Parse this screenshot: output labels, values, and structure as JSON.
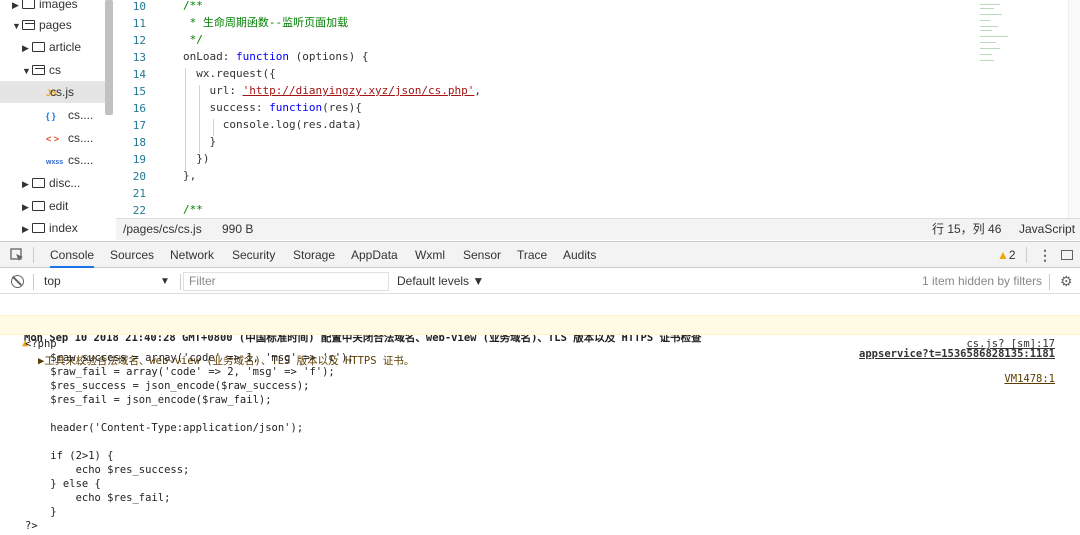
{
  "file_tree": {
    "items": [
      {
        "label": "images",
        "kind": "folder",
        "open": false
      },
      {
        "label": "pages",
        "kind": "folder",
        "open": true
      },
      {
        "label": "article",
        "kind": "folder",
        "open": false
      },
      {
        "label": "cs",
        "kind": "folder",
        "open": true
      },
      {
        "label": "cs.js",
        "kind": "js",
        "icon": "JS"
      },
      {
        "label": "cs....",
        "kind": "json",
        "icon": "{ }"
      },
      {
        "label": "cs....",
        "kind": "wxml",
        "icon": "< >"
      },
      {
        "label": "cs....",
        "kind": "wxss",
        "icon": "wxss"
      },
      {
        "label": "disc...",
        "kind": "folder",
        "open": false
      },
      {
        "label": "edit",
        "kind": "folder",
        "open": false
      },
      {
        "label": "index",
        "kind": "folder",
        "open": false
      }
    ]
  },
  "editor": {
    "line_numbers": [
      "10",
      "11",
      "12",
      "13",
      "14",
      "15",
      "16",
      "17",
      "18",
      "19",
      "20",
      "21",
      "22"
    ],
    "status_path": "/pages/cs/cs.js",
    "status_size": "990 B",
    "status_cursor": "行 15，列 46",
    "status_lang": "JavaScript"
  },
  "devtools": {
    "tabs": [
      "Console",
      "Sources",
      "Network",
      "Security",
      "Storage",
      "AppData",
      "Wxml",
      "Sensor",
      "Trace",
      "Audits"
    ],
    "active_tab": "Console",
    "warning_count": "2",
    "context": "top",
    "filter_placeholder": "Filter",
    "levels": "Default levels ▼",
    "hidden": "1 item hidden by filters"
  },
  "console": {
    "group_header": "Mon Sep 10 2018 21:40:28 GMT+0800 (中国标准时间) 配置中关闭合法域名、web-view (业务域名)、TLS 版本以及 HTTPS 证书检查",
    "group_link": "appservice?t=1536586828135:1181",
    "warning_text": "▶工具未校验合法域名、web-view (业务域名)、TLS 版本以及 HTTPS 证书。",
    "warning_link": "VM1478:1",
    "log_link": "cs.js? [sm]:17",
    "log_lines": [
      "<?php",
      "    $raw_success = array('code' => 1, 'msg' => 'c');",
      "    $raw_fail = array('code' => 2, 'msg' => 'f');",
      "    $res_success = json_encode($raw_success);",
      "    $res_fail = json_encode($raw_fail);",
      "",
      "    header('Content-Type:application/json');",
      "",
      "    if (2>1) {",
      "        echo $res_success;",
      "    } else {",
      "        echo $res_fail;",
      "    }",
      "?>"
    ]
  },
  "code": {
    "l10": "/**",
    "l11": " * 生命周期函数--监听页面加载",
    "l12": " */",
    "l13a": "onLoad: ",
    "l13b": "function",
    "l13c": " (options) {",
    "l14": "  wx.request({",
    "l15a": "    url: ",
    "l15b": "'http://dianyingzy.xyz/json/cs.php'",
    "l15c": ",",
    "l16a": "    success: ",
    "l16b": "function",
    "l16c": "(res){",
    "l17": "      console.log(res.data)",
    "l18": "    }",
    "l19": "  })",
    "l20": "},",
    "l22": "/**"
  }
}
